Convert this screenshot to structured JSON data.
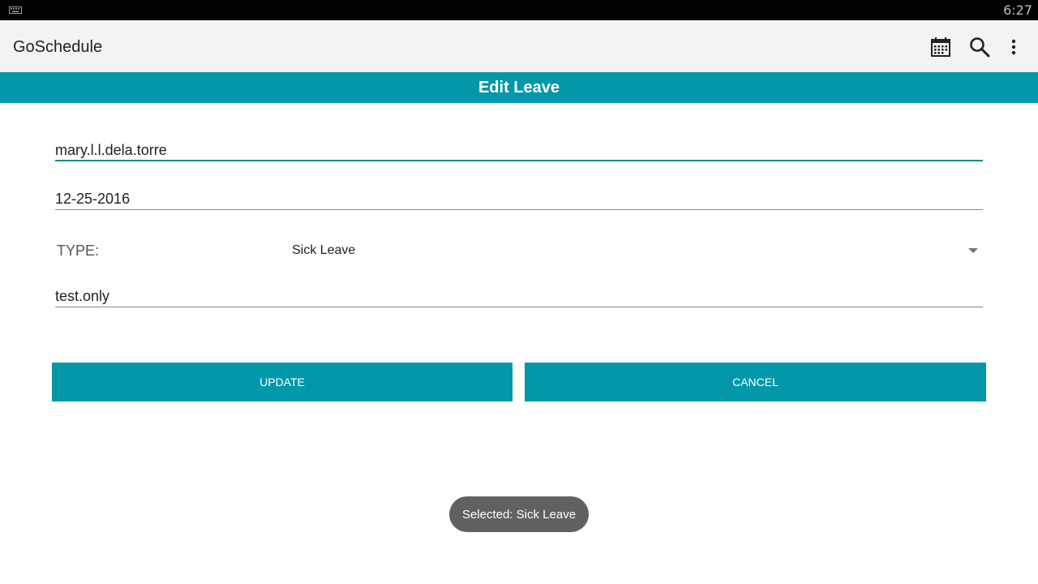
{
  "status_bar": {
    "time": "6:27",
    "keyboard_icon": "keyboard-icon"
  },
  "app_bar": {
    "title": "GoSchedule",
    "actions": [
      {
        "icon": "calendar-icon"
      },
      {
        "icon": "search-icon"
      },
      {
        "icon": "more-vert-icon"
      }
    ]
  },
  "screen": {
    "title": "Edit Leave"
  },
  "form": {
    "username": "mary.l.l.dela.torre",
    "date": "12-25-2016",
    "type_label": "TYPE:",
    "type_value": "Sick Leave",
    "remarks": "test.only"
  },
  "buttons": {
    "update": "UPDATE",
    "cancel": "CANCEL"
  },
  "toast": {
    "message": "Selected: Sick Leave"
  },
  "colors": {
    "accent": "#0397aa",
    "focused_underline": "#0e8f86",
    "app_bar_bg": "#f3f3f3",
    "status_bar_bg": "#000000",
    "toast_bg": "#616161"
  }
}
